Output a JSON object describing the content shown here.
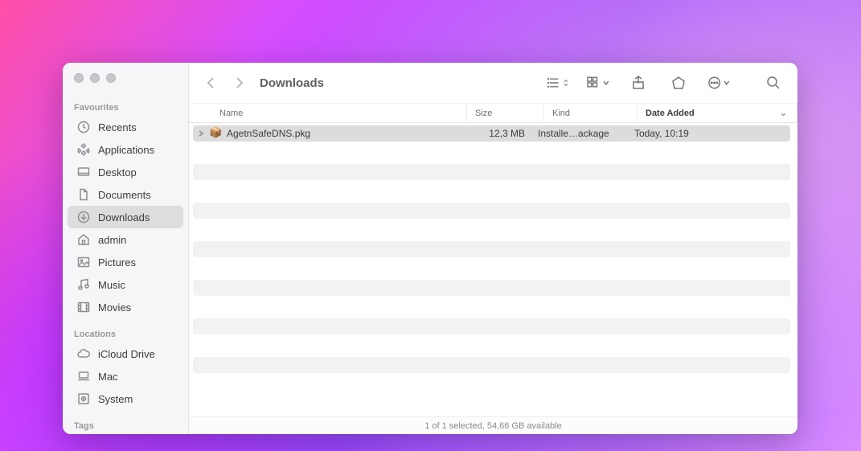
{
  "window": {
    "title": "Downloads"
  },
  "sidebar": {
    "sections": [
      {
        "label": "Favourites",
        "items": [
          {
            "icon": "clock-icon",
            "label": "Recents"
          },
          {
            "icon": "apps-icon",
            "label": "Applications"
          },
          {
            "icon": "desktop-icon",
            "label": "Desktop"
          },
          {
            "icon": "document-icon",
            "label": "Documents"
          },
          {
            "icon": "download-icon",
            "label": "Downloads",
            "selected": true
          },
          {
            "icon": "home-icon",
            "label": "admin"
          },
          {
            "icon": "picture-icon",
            "label": "Pictures"
          },
          {
            "icon": "music-icon",
            "label": "Music"
          },
          {
            "icon": "movie-icon",
            "label": "Movies"
          }
        ]
      },
      {
        "label": "Locations",
        "items": [
          {
            "icon": "cloud-icon",
            "label": "iCloud Drive"
          },
          {
            "icon": "laptop-icon",
            "label": "Mac"
          },
          {
            "icon": "disk-icon",
            "label": "System"
          }
        ]
      },
      {
        "label": "Tags",
        "items": []
      }
    ]
  },
  "columns": {
    "name": "Name",
    "size": "Size",
    "kind": "Kind",
    "date": "Date Added"
  },
  "files": [
    {
      "icon": "📦",
      "name": "AgetnSafeDNS.pkg",
      "size": "12,3 MB",
      "kind": "Installe…ackage",
      "date": "Today, 10:19",
      "selected": true
    }
  ],
  "emptyRows": 12,
  "status": "1 of 1 selected, 54,66 GB available"
}
